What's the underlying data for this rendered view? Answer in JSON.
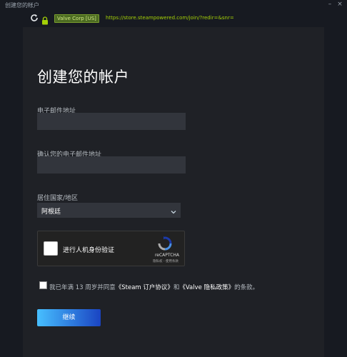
{
  "window": {
    "title": "创建您的帐户",
    "minimize": "–",
    "close": "×"
  },
  "address_bar": {
    "certificate": "Valve Corp [US]",
    "url": "https://store.steampowered.com/join/?redir=&snr="
  },
  "form": {
    "title": "创建您的帐户",
    "email_label": "电子邮件地址",
    "email_value": "",
    "confirm_email_label": "确认您的电子邮件地址",
    "confirm_email_value": "",
    "country_label": "居住国家/地区",
    "country_value": "阿根廷"
  },
  "recaptcha": {
    "label": "进行人机身份验证",
    "brand": "reCAPTCHA",
    "links": "隐私权 - 使用条款"
  },
  "agreement": {
    "prefix": "我已年满 13 周岁并同意",
    "ssa": "《Steam 订户协议》",
    "and": "和",
    "privacy": "《Valve 隐私政策》",
    "suffix": "的条款。"
  },
  "actions": {
    "continue_label": "继续"
  },
  "colors": {
    "background": "#171a21",
    "panel": "#1f2126",
    "input": "#32353c",
    "accent_start": "#47bfff",
    "accent_end": "#1a44c2",
    "cert_green": "#4c6b22",
    "url_green": "#a4d007"
  }
}
